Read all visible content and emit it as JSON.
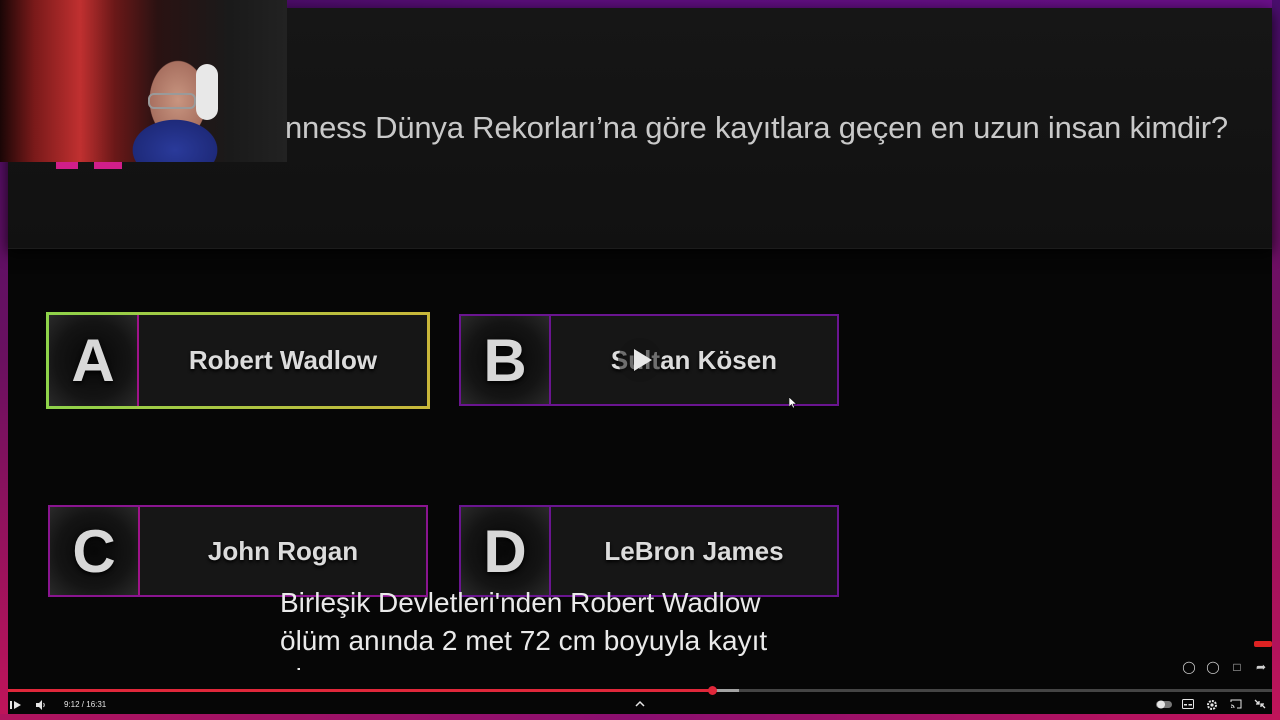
{
  "question": {
    "text": "nness Dünya Rekorları’na göre kayıtlara geçen en uzun insan kimdir?"
  },
  "options": [
    {
      "letter": "A",
      "text": "Robert Wadlow",
      "state": "selected"
    },
    {
      "letter": "B",
      "text": "Sultan Kösen",
      "state": "default"
    },
    {
      "letter": "C",
      "text": "John Rogan",
      "state": "default"
    },
    {
      "letter": "D",
      "text": "LeBron James",
      "state": "default"
    }
  ],
  "captions": {
    "line1": "Birleşik Devletleri'nden Robert Wadlow",
    "line2": "ölüm anında 2 met 72 cm boyuyla kayıt",
    "line3": "altına"
  },
  "player": {
    "time": "9:12 / 16:31",
    "progress_fraction": 0.557,
    "buffer_fraction": 0.578,
    "icons": {
      "play": "play-icon",
      "volume": "volume-icon",
      "expand": "chevron-up-icon",
      "autoplay": "autoplay-toggle-icon",
      "subtitles": "subtitles-icon",
      "settings": "gear-icon",
      "cast": "cast-icon",
      "exit_fullscreen": "exit-fullscreen-icon",
      "like": "thumbs-up-icon",
      "dislike": "thumbs-down-icon",
      "comments": "comment-icon",
      "share": "share-icon"
    }
  },
  "colors": {
    "frame_purple": "#5a0e7a",
    "frame_pink": "#c0145a",
    "option_border": "#a0138a",
    "correct_border": "#8fd34a",
    "progress_red": "#e0273a"
  }
}
